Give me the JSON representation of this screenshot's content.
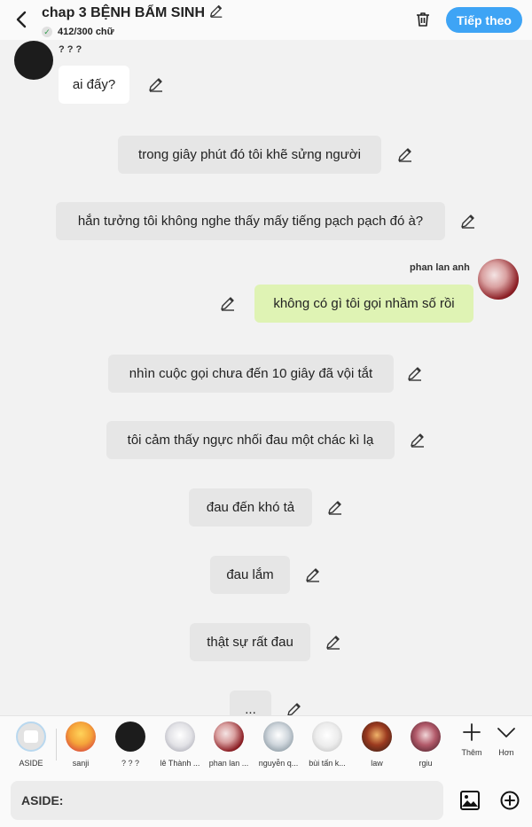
{
  "header": {
    "title": "chap 3 BỆNH BẨM SINH",
    "word_count": "412/300 chữ",
    "next_label": "Tiếp theo"
  },
  "chat": {
    "first_speaker": "? ? ?",
    "messages": [
      {
        "text": "ai đấy?"
      },
      {
        "text": "trong giây phút đó tôi khẽ sửng người"
      },
      {
        "text": "hắn tưởng tôi không nghe thấy mấy tiếng pạch pạch đó à?"
      },
      {
        "text": "không có gì tôi gọi nhầm số rồi",
        "speaker": "phan lan anh"
      },
      {
        "text": "nhìn cuộc gọi chưa đến 10 giây đã vội tắt"
      },
      {
        "text": "tôi cảm thấy ngực nhối đau một chác kì lạ"
      },
      {
        "text": "đau đến khó tả"
      },
      {
        "text": "đau lắm"
      },
      {
        "text": "thật sự rất đau"
      },
      {
        "text": "..."
      }
    ]
  },
  "characters": [
    {
      "name": "ASIDE"
    },
    {
      "name": "sanji"
    },
    {
      "name": "? ? ?"
    },
    {
      "name": "lê Thành ..."
    },
    {
      "name": "phan lan ..."
    },
    {
      "name": "nguyễn q..."
    },
    {
      "name": "bùi tấn k..."
    },
    {
      "name": "law"
    },
    {
      "name": "rgiu"
    }
  ],
  "tools": {
    "add_label": "Thêm",
    "more_label": "Hơn"
  },
  "input": {
    "value": "ASIDE:"
  },
  "colors": {
    "accent": "#3ea4f5",
    "user_bubble": "#dff3b4",
    "narration_bubble": "#e6e6e6",
    "background": "#f2f2f2"
  }
}
